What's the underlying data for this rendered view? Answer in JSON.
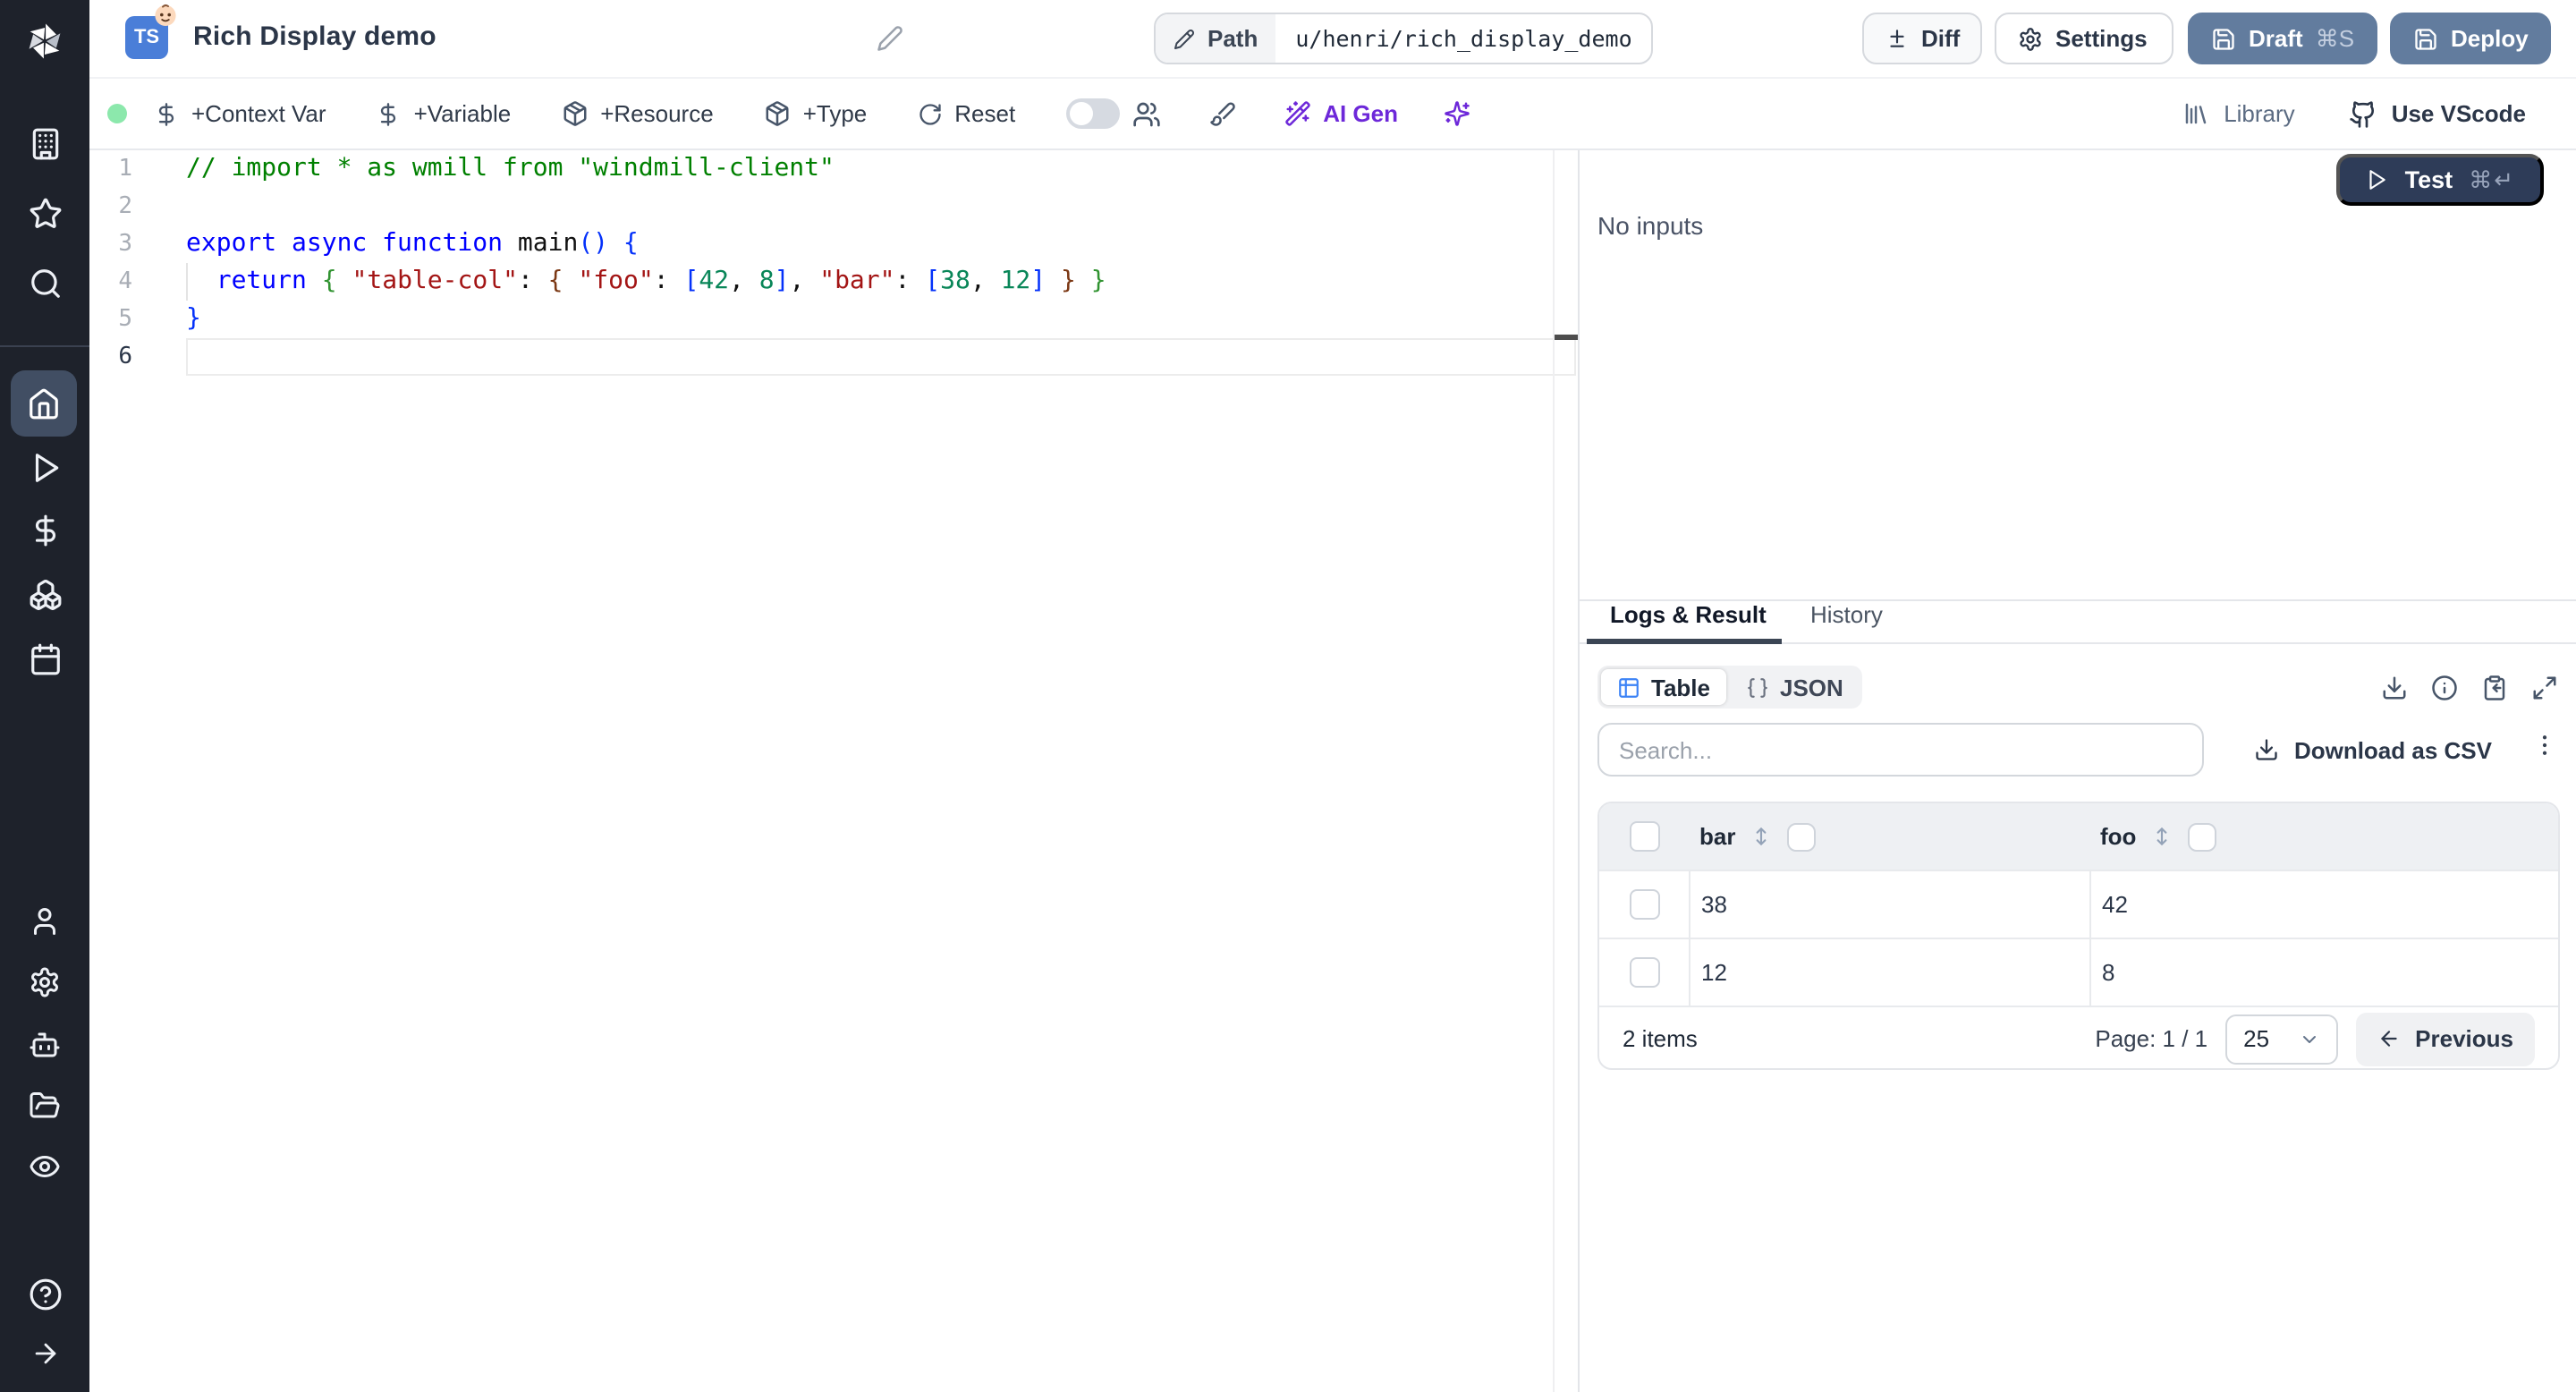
{
  "header": {
    "title": "Rich Display demo",
    "language_badge": "TS",
    "path_label": "Path",
    "path_value": "u/henri/rich_display_demo",
    "diff_label": "Diff",
    "settings_label": "Settings",
    "draft_label": "Draft",
    "draft_shortcut": "⌘S",
    "deploy_label": "Deploy"
  },
  "toolbar": {
    "context_var": "+Context Var",
    "variable": "+Variable",
    "resource": "+Resource",
    "type_label": "+Type",
    "reset": "Reset",
    "ai_gen": "AI Gen",
    "library": "Library",
    "use_vscode": "Use VScode",
    "status_dot_color": "#8ce8ac",
    "accent_purple": "#6d28d9"
  },
  "editor": {
    "lines": [
      {
        "num": "1",
        "current": false,
        "segments": [
          {
            "text": "// import * as wmill from \"windmill-client\"",
            "color": "comment"
          }
        ]
      },
      {
        "num": "2",
        "current": false,
        "segments": []
      },
      {
        "num": "3",
        "current": false,
        "segments": [
          {
            "text": "export async function ",
            "color": "keyword"
          },
          {
            "text": "main",
            "color": "plain"
          },
          {
            "text": "() {",
            "color": "bracket1"
          }
        ]
      },
      {
        "num": "4",
        "current": false,
        "segments": [
          {
            "text": "  ",
            "color": "plain"
          },
          {
            "text": "return",
            "color": "keyword"
          },
          {
            "text": " ",
            "color": "plain"
          },
          {
            "text": "{",
            "color": "bracket2"
          },
          {
            "text": " ",
            "color": "plain"
          },
          {
            "text": "\"table-col\"",
            "color": "string"
          },
          {
            "text": ": ",
            "color": "plain"
          },
          {
            "text": "{",
            "color": "bracket3"
          },
          {
            "text": " ",
            "color": "plain"
          },
          {
            "text": "\"foo\"",
            "color": "string"
          },
          {
            "text": ": ",
            "color": "plain"
          },
          {
            "text": "[",
            "color": "bracket1"
          },
          {
            "text": "42",
            "color": "number"
          },
          {
            "text": ", ",
            "color": "plain"
          },
          {
            "text": "8",
            "color": "number"
          },
          {
            "text": "]",
            "color": "bracket1"
          },
          {
            "text": ", ",
            "color": "plain"
          },
          {
            "text": "\"bar\"",
            "color": "string"
          },
          {
            "text": ": ",
            "color": "plain"
          },
          {
            "text": "[",
            "color": "bracket1"
          },
          {
            "text": "38",
            "color": "number"
          },
          {
            "text": ", ",
            "color": "plain"
          },
          {
            "text": "12",
            "color": "number"
          },
          {
            "text": "]",
            "color": "bracket1"
          },
          {
            "text": " ",
            "color": "plain"
          },
          {
            "text": "}",
            "color": "bracket3"
          },
          {
            "text": " ",
            "color": "plain"
          },
          {
            "text": "}",
            "color": "bracket2"
          }
        ]
      },
      {
        "num": "5",
        "current": false,
        "segments": [
          {
            "text": "}",
            "color": "bracket1"
          }
        ]
      },
      {
        "num": "6",
        "current": true,
        "segments": []
      }
    ]
  },
  "run_panel": {
    "test_label": "Test",
    "test_shortcut": "⌘↵",
    "no_inputs": "No inputs"
  },
  "result_panel": {
    "tabs": [
      {
        "label": "Logs & Result",
        "active": true
      },
      {
        "label": "History",
        "active": false
      }
    ],
    "view_toggle": [
      {
        "label": "Table",
        "active": true
      },
      {
        "label": "JSON",
        "active": false
      }
    ],
    "search_placeholder": "Search...",
    "download_csv": "Download as CSV",
    "table": {
      "columns": [
        "bar",
        "foo"
      ],
      "rows": [
        [
          "38",
          "42"
        ],
        [
          "12",
          "8"
        ]
      ],
      "items_text": "2 items",
      "page_text": "Page: 1 / 1",
      "page_size": "25",
      "prev_label": "Previous"
    }
  },
  "colors": {
    "sidebar_bg": "#1e222b",
    "sidebar_active_bg": "#414e63",
    "primary_button": "#627c9e",
    "test_button": "#2e3c58",
    "ts_badge": "#4a7ed8",
    "table_icon_blue": "#3b82f6"
  }
}
